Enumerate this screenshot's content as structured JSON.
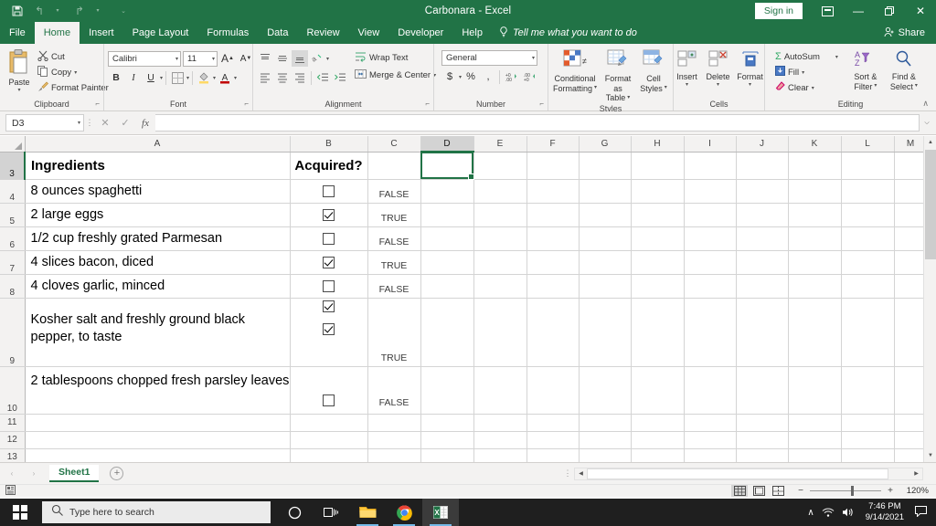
{
  "titlebar": {
    "document_title": "Carbonara  -  Excel",
    "quick_access": [
      {
        "name": "save",
        "glyph": "💾"
      },
      {
        "name": "undo",
        "glyph": "↶"
      },
      {
        "name": "redo",
        "glyph": "↷"
      },
      {
        "name": "customize",
        "glyph": "▾"
      }
    ],
    "sign_in": "Sign in",
    "ribbon_display_options": "⌸",
    "minimize": "—",
    "restore": "❐",
    "close": "✕"
  },
  "ribbon_tabs": {
    "items": [
      {
        "label": "File",
        "active": false
      },
      {
        "label": "Home",
        "active": true
      },
      {
        "label": "Insert",
        "active": false
      },
      {
        "label": "Page Layout",
        "active": false
      },
      {
        "label": "Formulas",
        "active": false
      },
      {
        "label": "Data",
        "active": false
      },
      {
        "label": "Review",
        "active": false
      },
      {
        "label": "View",
        "active": false
      },
      {
        "label": "Developer",
        "active": false
      },
      {
        "label": "Help",
        "active": false
      }
    ],
    "tell_me": "Tell me what you want to do",
    "share": "Share"
  },
  "ribbon": {
    "clipboard": {
      "label": "Clipboard",
      "paste": "Paste",
      "cut": "Cut",
      "copy": "Copy",
      "format_painter": "Format Painter"
    },
    "font": {
      "label": "Font",
      "font_name": "Calibri",
      "font_size": "11",
      "grow_font": "A",
      "shrink_font": "A",
      "bold": "B",
      "italic": "I",
      "underline": "U",
      "borders": "⊞",
      "fill_color": "A",
      "font_color": "A"
    },
    "alignment": {
      "label": "Alignment",
      "wrap_text": "Wrap Text",
      "merge_center": "Merge & Center"
    },
    "number": {
      "label": "Number",
      "format": "General",
      "currency": "$",
      "percent": "%",
      "comma": ",",
      "increase_decimal": "+.0",
      "decrease_decimal": "-.0"
    },
    "styles": {
      "label": "Styles",
      "conditional_formatting": "Conditional\nFormatting",
      "conditional_formatting_l1": "Conditional",
      "conditional_formatting_l2": "Formatting",
      "format_as_table_l1": "Format as",
      "format_as_table_l2": "Table",
      "cell_styles_l1": "Cell",
      "cell_styles_l2": "Styles"
    },
    "cells": {
      "label": "Cells",
      "insert": "Insert",
      "delete": "Delete",
      "format": "Format"
    },
    "editing": {
      "label": "Editing",
      "autosum": "AutoSum",
      "fill": "Fill",
      "clear": "Clear",
      "sort_filter_l1": "Sort &",
      "sort_filter_l2": "Filter",
      "find_select_l1": "Find &",
      "find_select_l2": "Select"
    },
    "collapse_ribbon": "∧"
  },
  "formula_bar": {
    "name_box": "D3",
    "cancel": "✕",
    "enter": "✓",
    "insert_function": "fx",
    "formula_value": "",
    "expand": "⌵"
  },
  "grid": {
    "columns": [
      "A",
      "B",
      "C",
      "D",
      "E",
      "F",
      "G",
      "H",
      "I",
      "J",
      "K",
      "L",
      "M"
    ],
    "selected_column": "D",
    "selected_row": "3",
    "selected_cell": "D3",
    "rows": [
      {
        "number": "3",
        "a": "Ingredients",
        "a_bold": true,
        "b_checkboxes": [],
        "c": ""
      },
      {
        "number": "4",
        "a": "8 ounces spaghetti",
        "a_bold": false,
        "b_checkboxes": [
          false
        ],
        "c": "FALSE"
      },
      {
        "number": "5",
        "a": "2 large eggs",
        "a_bold": false,
        "b_checkboxes": [
          true
        ],
        "c": "TRUE"
      },
      {
        "number": "6",
        "a": "1/2 cup freshly grated Parmesan",
        "a_bold": false,
        "b_checkboxes": [
          false
        ],
        "c": "FALSE"
      },
      {
        "number": "7",
        "a": "4 slices bacon, diced",
        "a_bold": false,
        "b_checkboxes": [
          true
        ],
        "c": "TRUE"
      },
      {
        "number": "8",
        "a": "4 cloves garlic, minced",
        "a_bold": false,
        "b_checkboxes": [
          false
        ],
        "c": "FALSE"
      },
      {
        "number": "9",
        "a": "Kosher salt and freshly ground black pepper, to taste",
        "a_bold": false,
        "b_checkboxes": [
          true,
          true
        ],
        "c": "TRUE"
      },
      {
        "number": "10",
        "a": "2 tablespoons chopped fresh parsley leaves",
        "a_bold": false,
        "b_checkboxes": [
          false
        ],
        "c": "FALSE"
      },
      {
        "number": "11",
        "a": "",
        "a_bold": false,
        "b_checkboxes": [],
        "c": ""
      },
      {
        "number": "12",
        "a": "",
        "a_bold": false,
        "b_checkboxes": [],
        "c": ""
      },
      {
        "number": "13",
        "a": "",
        "a_bold": false,
        "b_checkboxes": [],
        "c": ""
      }
    ],
    "header_b_label": "Acquired?"
  },
  "column_b_header": "Acquired?",
  "sheet_tabs": {
    "prev": "‹",
    "next": "›",
    "tabs": [
      "Sheet1"
    ],
    "active_tab": "Sheet1",
    "add_sheet": "+"
  },
  "status_bar": {
    "accessibility_icon": "☷",
    "view_normal": "⌸",
    "view_page_layout": "▤",
    "view_page_break": "▥",
    "zoom_out": "−",
    "zoom_in": "+",
    "zoom_level": "120%"
  },
  "taskbar": {
    "search_placeholder": "Type here to search",
    "cortana": "○",
    "task_view": "☰",
    "apps": [
      {
        "name": "file-explorer",
        "label": "File Explorer"
      },
      {
        "name": "chrome",
        "label": "Google Chrome"
      },
      {
        "name": "excel",
        "label": "Excel"
      }
    ],
    "tray": {
      "show_hidden": "∧",
      "network": "network",
      "volume": "volume"
    },
    "time": "7:46 PM",
    "date": "9/14/2021",
    "notifications": "□"
  },
  "colors": {
    "excel_green": "#217346",
    "ribbon_bg": "#f3f2f1",
    "selection_green": "#217346",
    "taskbar_bg": "#1f1f1f"
  }
}
